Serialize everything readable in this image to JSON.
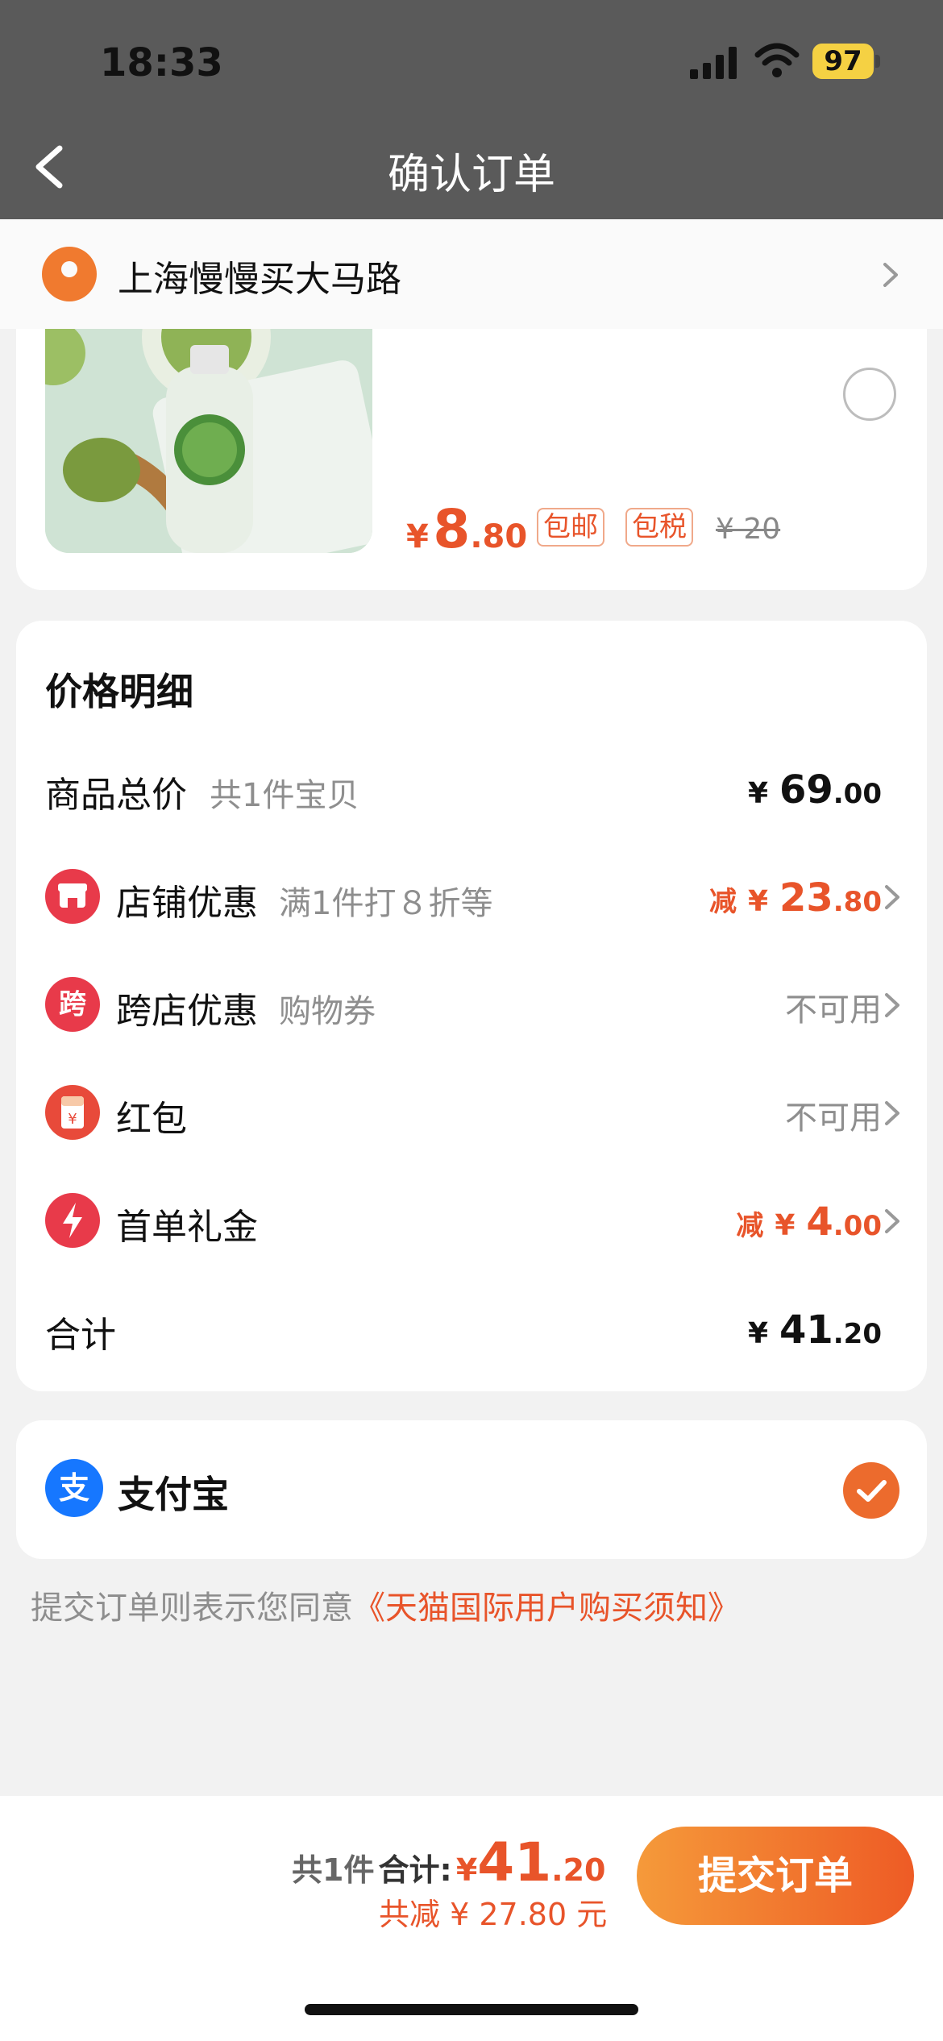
{
  "status": {
    "time": "18:33",
    "battery": "97"
  },
  "nav": {
    "title": "确认订单"
  },
  "address": {
    "text": "上海慢慢买大马路"
  },
  "product": {
    "price_symbol": "¥",
    "price_int": "8",
    "price_dec": ".80",
    "tags": [
      "包邮",
      "包税"
    ],
    "original_price": "¥ 20"
  },
  "detail": {
    "title": "价格明细",
    "rows": [
      {
        "label": "商品总价",
        "sub": "共1件宝贝",
        "sym": "¥",
        "int": "69",
        "dec": ".00"
      },
      {
        "label": "店铺优惠",
        "sub": "满1件打８折等",
        "prefix": "减",
        "sym": "¥",
        "int": "23",
        "dec": ".80"
      },
      {
        "label": "跨店优惠",
        "sub": "购物券",
        "value": "不可用"
      },
      {
        "label": "红包",
        "value": "不可用"
      },
      {
        "label": "首单礼金",
        "prefix": "减",
        "sym": "¥",
        "int": "4",
        "dec": ".00"
      },
      {
        "label": "合计",
        "sym": "¥",
        "int": "41",
        "dec": ".20"
      }
    ],
    "icons": {
      "shop_glyph": "",
      "cross_glyph": "跨",
      "redpacket_glyph": "¥",
      "bolt_glyph": ""
    }
  },
  "payment": {
    "label": "支付宝",
    "alipay_glyph": "支"
  },
  "agreement": {
    "text": "提交订单则表示您同意",
    "link": "《天猫国际用户购买须知》"
  },
  "bottom_bar": {
    "count": "共1件",
    "total_label": "合计:",
    "total_sym": "¥",
    "total_int": "41",
    "total_dec": ".20",
    "savings": "共减 ¥ 27.80 元",
    "submit": "提交订单"
  },
  "colors": {
    "accent": "#e8542a",
    "nav_bg": "#5a5a5a",
    "button_from": "#f59a3a",
    "button_to": "#ee5b25"
  }
}
